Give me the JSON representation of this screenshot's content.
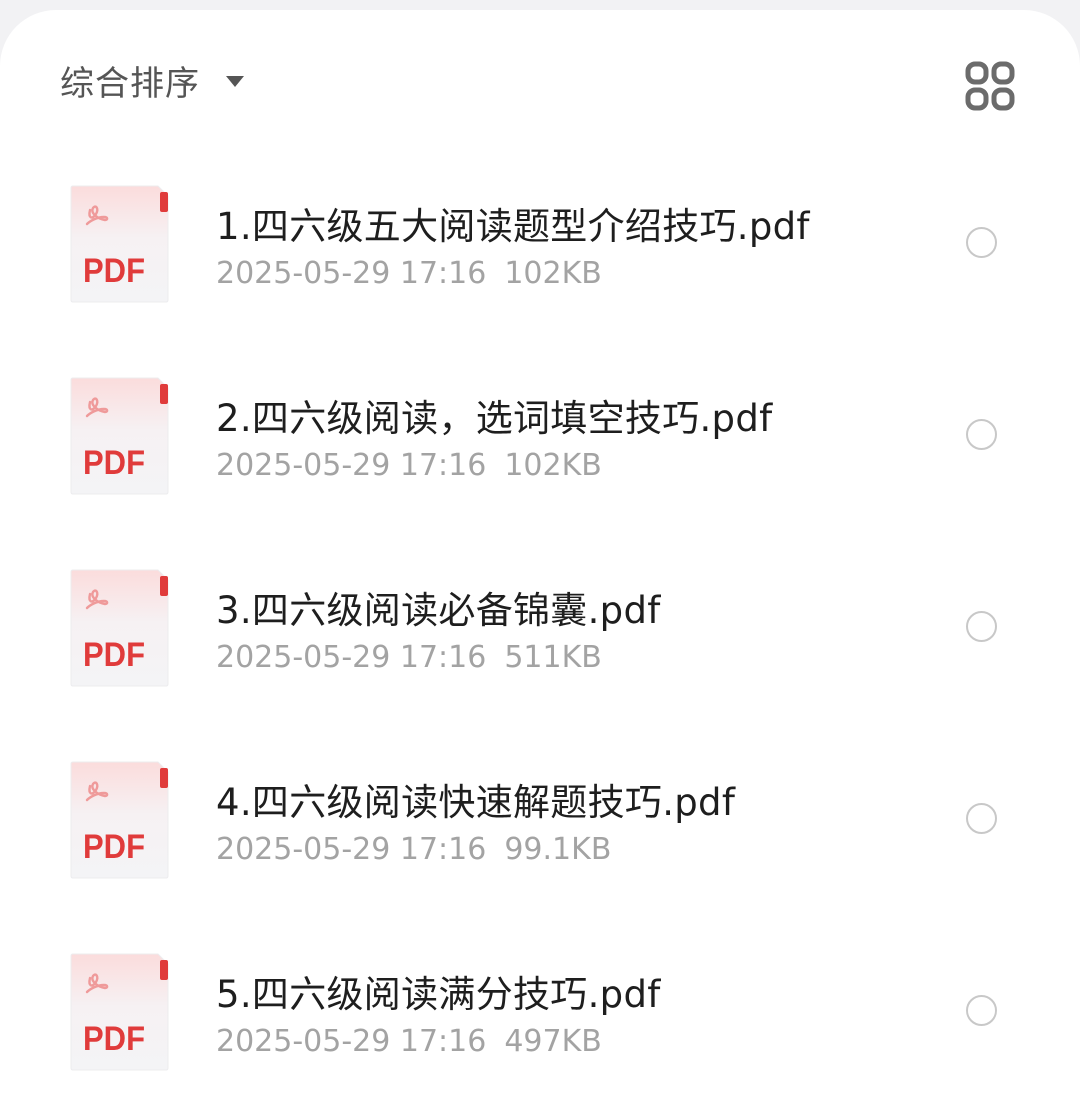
{
  "toolbar": {
    "sort_label": "综合排序",
    "sort_icon": "caret-down-icon",
    "view_toggle_icon": "grid-view-icon"
  },
  "files": [
    {
      "name": "1.四六级五大阅读题型介绍技巧.pdf",
      "date": "2025-05-29 17:16",
      "size": "102KB",
      "type_label": "PDF",
      "selected": false
    },
    {
      "name": "2.四六级阅读，选词填空技巧.pdf",
      "date": "2025-05-29 17:16",
      "size": "102KB",
      "type_label": "PDF",
      "selected": false
    },
    {
      "name": "3.四六级阅读必备锦囊.pdf",
      "date": "2025-05-29 17:16",
      "size": "511KB",
      "type_label": "PDF",
      "selected": false
    },
    {
      "name": "4.四六级阅读快速解题技巧.pdf",
      "date": "2025-05-29 17:16",
      "size": "99.1KB",
      "type_label": "PDF",
      "selected": false
    },
    {
      "name": "5.四六级阅读满分技巧.pdf",
      "date": "2025-05-29 17:16",
      "size": "497KB",
      "type_label": "PDF",
      "selected": false
    }
  ],
  "colors": {
    "pdf_accent": "#e03b3b",
    "icon_background": "#f5f5f7",
    "title_text": "#1e1e1e",
    "meta_text": "#a3a3a3",
    "radio_border": "#c8c8c8",
    "sheet_background": "#ffffff"
  }
}
